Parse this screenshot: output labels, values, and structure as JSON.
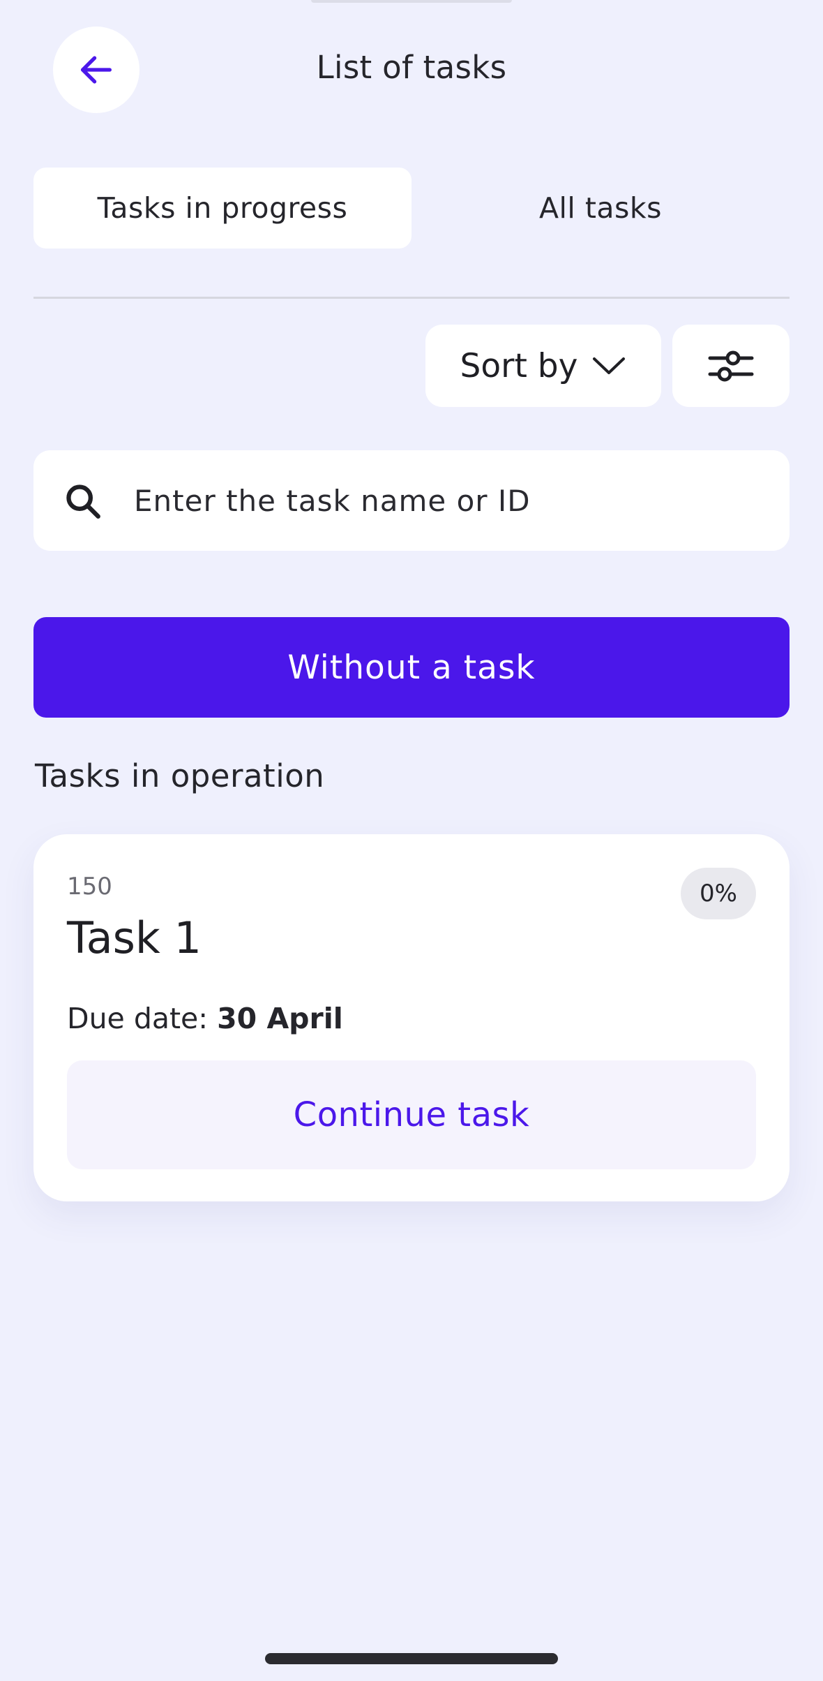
{
  "header": {
    "title": "List of tasks",
    "back_icon": "arrow-left-icon"
  },
  "tabs": [
    {
      "label": "Tasks in progress",
      "active": true
    },
    {
      "label": "All tasks",
      "active": false
    }
  ],
  "toolbar": {
    "sort_label": "Sort by",
    "sort_icon": "chevron-down-icon",
    "filter_icon": "sliders-icon"
  },
  "search": {
    "placeholder": "Enter the task name or ID",
    "value": ""
  },
  "primary_action": {
    "label": "Without a task"
  },
  "section": {
    "title": "Tasks in operation"
  },
  "tasks": [
    {
      "id": "150",
      "progress": "0%",
      "title": "Task 1",
      "due_label": "Due date:",
      "due_value": "30 April",
      "action_label": "Continue task"
    }
  ],
  "colors": {
    "background": "#eff0fd",
    "accent": "#4b17ea",
    "card": "#ffffff"
  }
}
